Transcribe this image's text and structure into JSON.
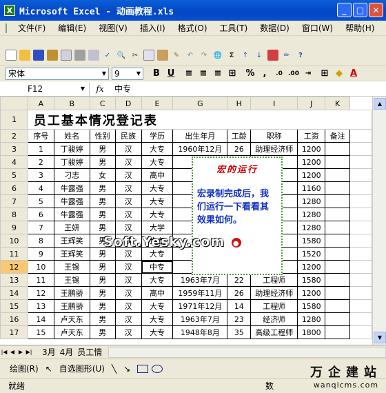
{
  "window": {
    "title": "Microsoft Excel - 动画教程.xls"
  },
  "menu": [
    "文件(F)",
    "编辑(E)",
    "视图(V)",
    "插入(I)",
    "格式(O)",
    "工具(T)",
    "数据(D)",
    "窗口(W)",
    "帮助(H)"
  ],
  "format": {
    "font": "宋体",
    "size": "9",
    "bold": "B",
    "underline": "U"
  },
  "formula": {
    "cell": "F12",
    "fx": "fx",
    "value": "中专"
  },
  "columns": [
    "A",
    "B",
    "C",
    "D",
    "E",
    "F",
    "G",
    "H",
    "I",
    "J",
    "K"
  ],
  "title_row": {
    "num": "1",
    "text": "员工基本情况登记表"
  },
  "header_row": {
    "num": "2",
    "cells": [
      "序号",
      "姓名",
      "性别",
      "民族",
      "学历",
      "出生年月",
      "工龄",
      "职称",
      "工资",
      "备注"
    ]
  },
  "rows": [
    {
      "num": "3",
      "cells": [
        "1",
        "丁骏婷",
        "男",
        "汉",
        "大专",
        "1960年12月",
        "26",
        "助理经济师",
        "1200",
        ""
      ]
    },
    {
      "num": "4",
      "cells": [
        "2",
        "丁骏婷",
        "男",
        "汉",
        "大专",
        "195",
        "",
        "",
        "1200",
        ""
      ]
    },
    {
      "num": "5",
      "cells": [
        "3",
        "刁志",
        "女",
        "汉",
        "高中",
        "196",
        "",
        "",
        "1200",
        ""
      ]
    },
    {
      "num": "6",
      "cells": [
        "4",
        "牛露强",
        "男",
        "汉",
        "大专",
        "196",
        "",
        "",
        "1160",
        ""
      ]
    },
    {
      "num": "7",
      "cells": [
        "5",
        "牛露强",
        "男",
        "汉",
        "大专",
        "194",
        "",
        "",
        "1280",
        ""
      ]
    },
    {
      "num": "8",
      "cells": [
        "6",
        "牛露强",
        "男",
        "汉",
        "大专",
        "194",
        "",
        "",
        "1280",
        ""
      ]
    },
    {
      "num": "9",
      "cells": [
        "7",
        "王妍",
        "男",
        "汉",
        "大学",
        "197",
        "",
        "",
        "1280",
        ""
      ]
    },
    {
      "num": "10",
      "cells": [
        "8",
        "王辉笑",
        "男",
        "汉",
        "大专",
        "",
        "",
        "",
        "1580",
        ""
      ]
    },
    {
      "num": "11",
      "cells": [
        "9",
        "王辉笑",
        "男",
        "汉",
        "大专",
        "194",
        "",
        "",
        "1520",
        ""
      ]
    },
    {
      "num": "12",
      "cells": [
        "10",
        "王锡",
        "男",
        "汉",
        "中专",
        "195",
        "",
        "",
        "1200",
        ""
      ]
    },
    {
      "num": "13",
      "cells": [
        "11",
        "王锡",
        "男",
        "汉",
        "大专",
        "1963年7月",
        "22",
        "工程师",
        "1580",
        ""
      ]
    },
    {
      "num": "14",
      "cells": [
        "12",
        "王鹏骄",
        "男",
        "汉",
        "高中",
        "1959年11月",
        "26",
        "助理经济师",
        "1200",
        ""
      ]
    },
    {
      "num": "15",
      "cells": [
        "13",
        "王鹏骄",
        "男",
        "汉",
        "大专",
        "1971年12月",
        "14",
        "工程师",
        "1580",
        ""
      ]
    },
    {
      "num": "16",
      "cells": [
        "14",
        "卢天东",
        "男",
        "汉",
        "大专",
        "1963年7月",
        "23",
        "经济师",
        "1280",
        ""
      ]
    },
    {
      "num": "17",
      "cells": [
        "15",
        "卢天东",
        "男",
        "汉",
        "大专",
        "1948年8月",
        "35",
        "高级工程师",
        "1800",
        ""
      ]
    }
  ],
  "popup": {
    "title": "宏的运行",
    "body": "宏录制完成后，我们运行一下看看其效果如何。"
  },
  "watermark": "Soft.Yesky.com",
  "sheet_tabs": [
    "3月",
    "4月",
    "员工情"
  ],
  "drawbar": {
    "draw": "绘图(R)",
    "autoshapes": "自选图形(U)"
  },
  "status": {
    "ready": "就绪",
    "num": "数"
  },
  "brand": {
    "cn": "万企建站",
    "url": "wanqicms.com"
  }
}
